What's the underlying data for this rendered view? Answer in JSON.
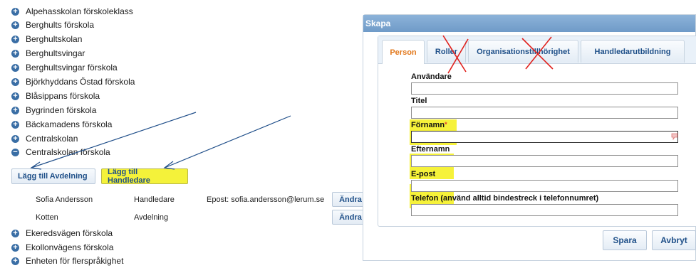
{
  "tree": {
    "items": [
      {
        "label": "Alpehasskolan förskoleklass",
        "state": "collapsed"
      },
      {
        "label": "Berghults förskola",
        "state": "collapsed"
      },
      {
        "label": "Berghultskolan",
        "state": "collapsed"
      },
      {
        "label": "Berghultsvingar",
        "state": "collapsed"
      },
      {
        "label": "Berghultsvingar förskola",
        "state": "collapsed"
      },
      {
        "label": "Björkhyddans Östad förskola",
        "state": "collapsed"
      },
      {
        "label": "Blåsippans förskola",
        "state": "collapsed"
      },
      {
        "label": "Bygrinden förskola",
        "state": "collapsed"
      },
      {
        "label": "Bäckamadens förskola",
        "state": "collapsed"
      },
      {
        "label": "Centralskolan",
        "state": "collapsed"
      },
      {
        "label": "Centralskolan förskola",
        "state": "expanded"
      }
    ],
    "add_unit_button": "Lägg till Avdelning",
    "add_supervisor_button": "Lägg till Handledare",
    "sub_rows": [
      {
        "name": "Sofia Andersson",
        "role": "Handledare",
        "email": "Epost: sofia.andersson@lerum.se",
        "action": "Ändra"
      },
      {
        "name": "Kotten",
        "role": "Avdelning",
        "email": "",
        "action": "Ändra"
      }
    ],
    "items_after": [
      {
        "label": "Ekeredsvägen förskola",
        "state": "collapsed"
      },
      {
        "label": "Ekollonvägens förskola",
        "state": "collapsed"
      },
      {
        "label": "Enheten för flerspråkighet",
        "state": "collapsed"
      }
    ]
  },
  "dialog": {
    "title": "Skapa",
    "tabs": [
      {
        "label": "Person",
        "active": true
      },
      {
        "label": "Roller",
        "active": false
      },
      {
        "label": "Organisationstillhörighet",
        "active": false
      },
      {
        "label": "Handledarutbildning",
        "active": false
      }
    ],
    "fields": [
      {
        "label": "Användare",
        "value": ""
      },
      {
        "label": "Titel",
        "value": ""
      },
      {
        "label": "Förnamn",
        "value": "",
        "required_marker": "*"
      },
      {
        "label": "Efternamn",
        "value": ""
      },
      {
        "label": "E-post",
        "value": ""
      },
      {
        "label": "Telefon (använd alltid bindestreck i telefonnumret)",
        "value": ""
      }
    ],
    "save_button": "Spara",
    "cancel_button": "Avbryt"
  },
  "colors": {
    "highlight": "#f6f23a",
    "annotation_red": "#e0201c",
    "annotation_arrow": "#1f4e89",
    "tree_icon": "#3a6ea5",
    "active_tab_text": "#e2781c",
    "dialog_header": "#7ba5cf"
  },
  "icons": {
    "collapsed": "plus-circle-icon",
    "expanded": "minus-circle-icon",
    "validation": "speech-bubble-icon"
  }
}
